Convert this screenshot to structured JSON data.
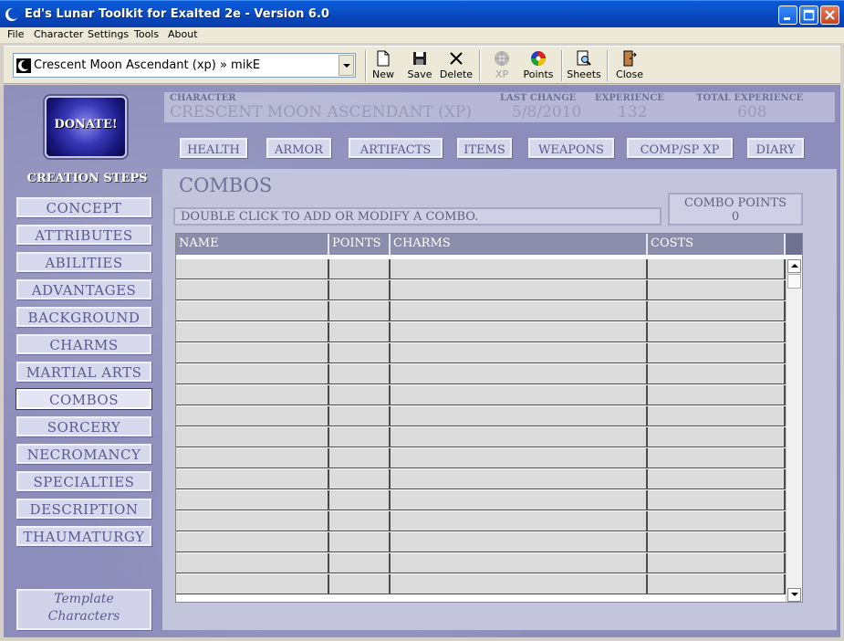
{
  "window": {
    "title": "Ed's Lunar Toolkit for Exalted 2e - Version 6.0"
  },
  "menu": [
    "File",
    "Character",
    "Settings",
    "Tools",
    "About"
  ],
  "toolbar": {
    "character_select": "Crescent Moon Ascendant (xp) » mikE",
    "buttons": {
      "new": "New",
      "save": "Save",
      "delete": "Delete",
      "xp": "XP",
      "points": "Points",
      "sheets": "Sheets",
      "close": "Close"
    }
  },
  "sidebar": {
    "donate_label": "DONATE!",
    "creation_steps_title": "CREATION STEPS",
    "steps": [
      "CONCEPT",
      "ATTRIBUTES",
      "ABILITIES",
      "ADVANTAGES",
      "BACKGROUND",
      "CHARMS",
      "MARTIAL ARTS",
      "COMBOS",
      "SORCERY",
      "NECROMANCY",
      "SPECIALTIES",
      "DESCRIPTION",
      "THAUMATURGY"
    ],
    "active_step": "COMBOS",
    "template_line1": "Template",
    "template_line2": "Characters"
  },
  "header": {
    "character_label": "CHARACTER",
    "character_value": "CRESCENT MOON ASCENDANT (XP)",
    "last_change_label": "LAST CHANGE",
    "last_change_value": "5/8/2010",
    "experience_label": "EXPERIENCE",
    "experience_value": "132",
    "total_experience_label": "TOTAL EXPERIENCE",
    "total_experience_value": "608"
  },
  "nav_tabs": [
    "HEALTH",
    "ARMOR",
    "ARTIFACTS",
    "ITEMS",
    "WEAPONS",
    "COMP/SP XP",
    "DIARY"
  ],
  "panel": {
    "title": "COMBOS",
    "hint": "DOUBLE CLICK TO ADD OR MODIFY A COMBO.",
    "combo_points_label": "COMBO POINTS",
    "combo_points_value": "0"
  },
  "table": {
    "columns": [
      "NAME",
      "POINTS",
      "CHARMS",
      "COSTS"
    ],
    "row_count": 16
  },
  "colors": {
    "titlebar": "#0a4fc8",
    "background": "#8c8dba",
    "panel": "#c4c4dc",
    "header_grid": "#8c8cab",
    "step_text": "#5a5a90"
  }
}
